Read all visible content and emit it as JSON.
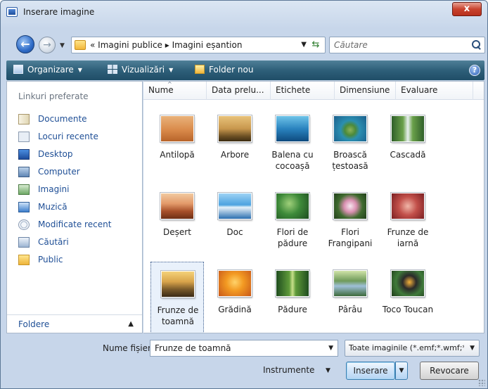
{
  "window": {
    "title": "Inserare imagine",
    "close_glyph": "x"
  },
  "nav": {
    "back_glyph": "←",
    "forward_glyph": "→",
    "dropdown_glyph": "▼",
    "breadcrumb": "« Imagini publice ▸ Imagini eșantion",
    "refresh_glyph": "⇆",
    "search_placeholder": "Căutare"
  },
  "toolbar": {
    "organize": "Organizare",
    "views": "Vizualizări",
    "new_folder": "Folder nou",
    "arrow": "▼",
    "help": "?"
  },
  "sidebar": {
    "header": "Linkuri preferate",
    "items": [
      {
        "label": "Documente",
        "icon": "documents-icon"
      },
      {
        "label": "Locuri recente",
        "icon": "recent-places-icon"
      },
      {
        "label": "Desktop",
        "icon": "desktop-icon"
      },
      {
        "label": "Computer",
        "icon": "computer-icon"
      },
      {
        "label": "Imagini",
        "icon": "pictures-icon"
      },
      {
        "label": "Muzică",
        "icon": "music-icon"
      },
      {
        "label": "Modificate recent",
        "icon": "recently-changed-icon"
      },
      {
        "label": "Căutări",
        "icon": "searches-icon"
      },
      {
        "label": "Public",
        "icon": "public-folder-icon"
      }
    ],
    "folders_label": "Foldere",
    "folders_chevron": "▲"
  },
  "columns": [
    "Nume",
    "Data prelu...",
    "Etichete",
    "Dimensiune",
    "Evaluare"
  ],
  "sort_caret": "^",
  "files": [
    {
      "name": "Antilopă",
      "thumb": "linear-gradient(#e9b27a 0%, #d98a4a 55%, #b8642a 100%)"
    },
    {
      "name": "Arbore",
      "thumb": "linear-gradient(#e8c27a 0%, #c8974d 50%, #6b4f24 80%, #3d2d12 100%)"
    },
    {
      "name": "Balena cu\ncocoașă",
      "thumb": "linear-gradient(#6ec3e8 0%, #2a83bf 50%, #0e4a7e 100%)"
    },
    {
      "name": "Broască\nțestoasă",
      "thumb": "radial-gradient(circle at 50% 55%, #8fb35a 0%, #4c8a3a 25%, #2b8fb1 45%, #1a5e8c 100%)"
    },
    {
      "name": "Cascadă",
      "thumb": "linear-gradient(90deg, #2f5f2a 0%, #6aa04a 35%, #e8f0f0 50%, #6aa04a 65%, #2f5f2a 100%)"
    },
    {
      "name": "Deșert",
      "thumb": "linear-gradient(#f2c9a0 0%, #e39a6a 40%, #a8502a 70%, #6e2f16 100%)"
    },
    {
      "name": "Doc",
      "thumb": "linear-gradient(#9ed2f5 0%, #4da3e0 45%, #e6f2fa 55%, #2b6fb0 100%)"
    },
    {
      "name": "Flori de\npădure",
      "thumb": "radial-gradient(circle at 40% 40%, #9fd07a 0%, #3e8a3a 45%, #1d4d20 100%)"
    },
    {
      "name": "Flori\nFrangipani",
      "thumb": "radial-gradient(circle at 50% 50%, #f6e7ef 0%, #d98fb0 30%, #3f6b2f 60%, #22401c 100%)"
    },
    {
      "name": "Frunze de\niarnă",
      "thumb": "radial-gradient(circle at 50% 50%, #f0b6a8 0%, #c2504a 45%, #7a1f22 100%)"
    },
    {
      "name": "Frunze de\ntoamnă",
      "thumb": "linear-gradient(#f4d27a 0%, #d9a44a 40%, #7a5a2a 70%, #3a2a14 100%)",
      "selected": true
    },
    {
      "name": "Grădină",
      "thumb": "radial-gradient(circle at 50% 45%, #ffd36a 0%, #f39a22 40%, #c8581a 100%)"
    },
    {
      "name": "Pădure",
      "thumb": "linear-gradient(90deg, #1f4d1f 0%, #5f9a3a 40%, #c8e08a 50%, #5f9a3a 60%, #1f4d1f 100%)"
    },
    {
      "name": "Pârâu",
      "thumb": "linear-gradient(#cfe3a8 0%, #6f9a5a 40%, #9fc0d8 60%, #3d6a3a 100%)"
    },
    {
      "name": "Toco Toucan",
      "thumb": "radial-gradient(circle at 55% 45%, #f6b23a 0%, #2a2a2a 30%, #3f7a3a 60%, #1f3d1a 100%)"
    }
  ],
  "footer": {
    "filename_label": "Nume fișier:",
    "filename_value": "Frunze de toamnă",
    "filter_value": "Toate imaginile (*.emf;*.wmf;*.j",
    "tools_label": "Instrumente",
    "insert_label": "Inserare",
    "cancel_label": "Revocare",
    "dropdown_glyph": "▼"
  }
}
